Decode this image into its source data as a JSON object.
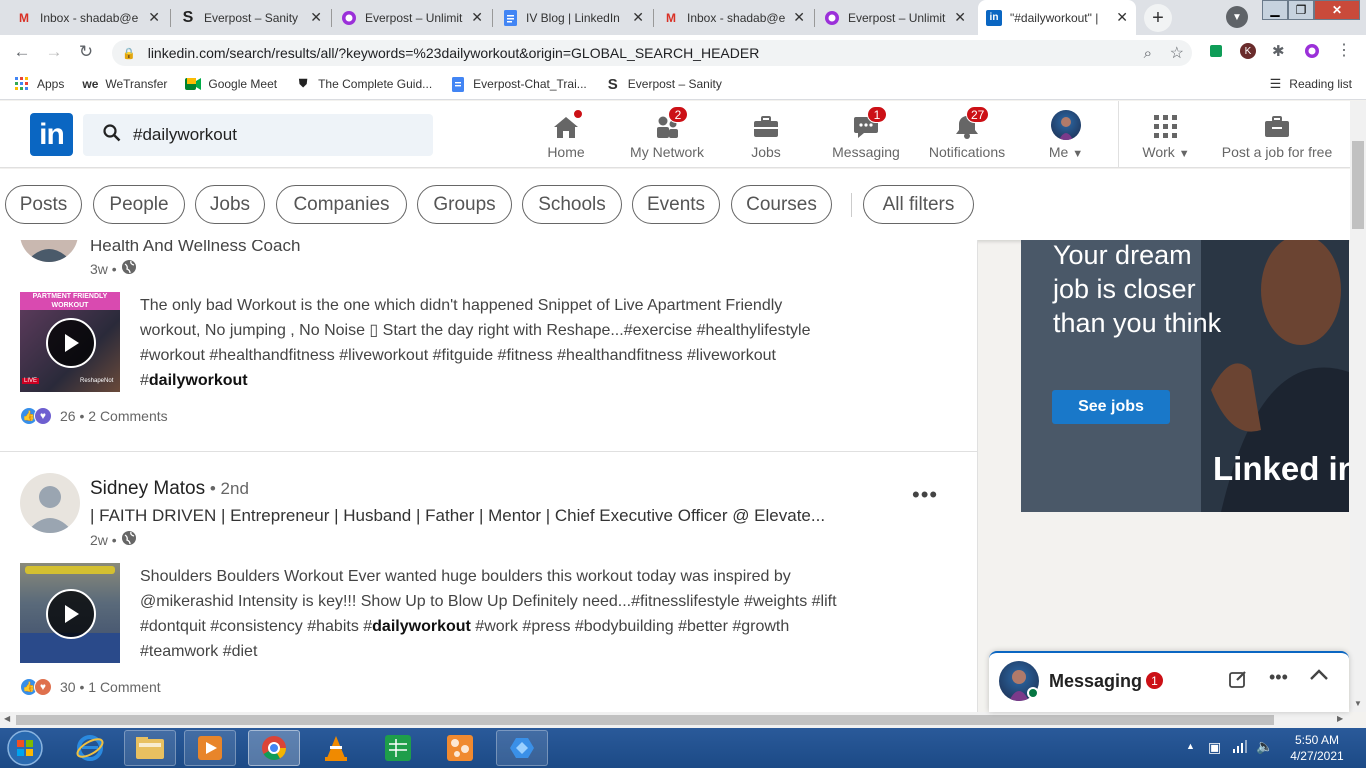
{
  "browser": {
    "tabs": [
      {
        "title": "Inbox - shadab@e",
        "icon": "gmail-icon",
        "active": false
      },
      {
        "title": "Everpost – Sanity",
        "icon": "sanity-icon",
        "active": false
      },
      {
        "title": "Everpost – Unlimit",
        "icon": "everpost-icon",
        "active": false
      },
      {
        "title": "IV Blog | LinkedIn",
        "icon": "google-docs-icon",
        "active": false
      },
      {
        "title": "Inbox - shadab@e",
        "icon": "gmail-icon",
        "active": false
      },
      {
        "title": "Everpost – Unlimit",
        "icon": "everpost-icon",
        "active": false
      },
      {
        "title": "\"#dailyworkout\" |",
        "icon": "linkedin-icon",
        "active": true
      }
    ],
    "url": "linkedin.com/search/results/all/?keywords=%23dailyworkout&origin=GLOBAL_SEARCH_HEADER",
    "bookmarks": [
      {
        "label": "Apps",
        "icon": "apps-grid-icon"
      },
      {
        "label": "WeTransfer",
        "icon": "wetransfer-icon"
      },
      {
        "label": "Google Meet",
        "icon": "google-meet-icon"
      },
      {
        "label": "The Complete Guid...",
        "icon": "shield-bookmark-icon"
      },
      {
        "label": "Everpost-Chat_Trai...",
        "icon": "google-docs-icon"
      },
      {
        "label": "Everpost – Sanity",
        "icon": "sanity-icon"
      }
    ],
    "reading_list": "Reading list"
  },
  "linkedin": {
    "logo": "in",
    "search_value": "#dailyworkout",
    "nav": [
      {
        "label": "Home",
        "icon": "home-icon",
        "badge": ""
      },
      {
        "label": "My Network",
        "icon": "network-icon",
        "badge": "2"
      },
      {
        "label": "Jobs",
        "icon": "briefcase-icon",
        "badge": ""
      },
      {
        "label": "Messaging",
        "icon": "messaging-icon",
        "badge": "1"
      },
      {
        "label": "Notifications",
        "icon": "bell-icon",
        "badge": "27"
      },
      {
        "label": "Me",
        "icon": "avatar",
        "badge": ""
      },
      {
        "label": "Work",
        "icon": "grid-icon",
        "badge": ""
      },
      {
        "label": "Post a job for free",
        "icon": "post-job-icon",
        "badge": ""
      }
    ],
    "filters": [
      "Posts",
      "People",
      "Jobs",
      "Companies",
      "Groups",
      "Schools",
      "Events",
      "Courses",
      "All filters"
    ]
  },
  "posts": [
    {
      "headline": "Health And Wellness Coach",
      "time": "3w",
      "text_before": "The only bad Workout is the one which didn't happened Snippet of Live Apartment Friendly workout, No jumping , No Noise ▯ Start the day right with Reshape...#exercise #healthylifestyle #workout #healthandfitness #liveworkout #fitguide #fitness #healthandfitness #liveworkout #",
      "text_bold": "dailyworkout",
      "text_after": "",
      "thumb_caption": "PARTMENT FRIENDLY WORKOUT",
      "thumb_live": "LIVE",
      "thumb_brand": "ReshapeNot",
      "reactions": "26",
      "comments": "2 Comments"
    },
    {
      "author": "Sidney Matos",
      "degree": "2nd",
      "headline": "| FAITH DRIVEN | Entrepreneur | Husband | Father | Mentor | Chief Executive Officer @ Elevate...",
      "time": "2w",
      "text_before": "Shoulders Boulders Workout Ever wanted huge boulders this workout today was inspired by @mikerashid Intensity is key!!! Show Up to Blow Up Definitely need...#fitnesslifestyle #weights #lift #dontquit #consistency #habits #",
      "text_bold": "dailyworkout",
      "text_after": " #work #press #bodybuilding #better #growth #teamwork #diet",
      "reactions": "30",
      "comments": "1 Comment"
    }
  ],
  "ad": {
    "headline": "Your dream job is closer than you think",
    "cta": "See jobs",
    "brand": "Linked in"
  },
  "messaging": {
    "title": "Messaging",
    "badge": "1"
  },
  "taskbar": {
    "time": "5:50 AM",
    "date": "4/27/2021"
  },
  "colors": {
    "linkedin_blue": "#0a66c2",
    "badge_red": "#cc1016",
    "tabstrip": "#dee1e6"
  }
}
